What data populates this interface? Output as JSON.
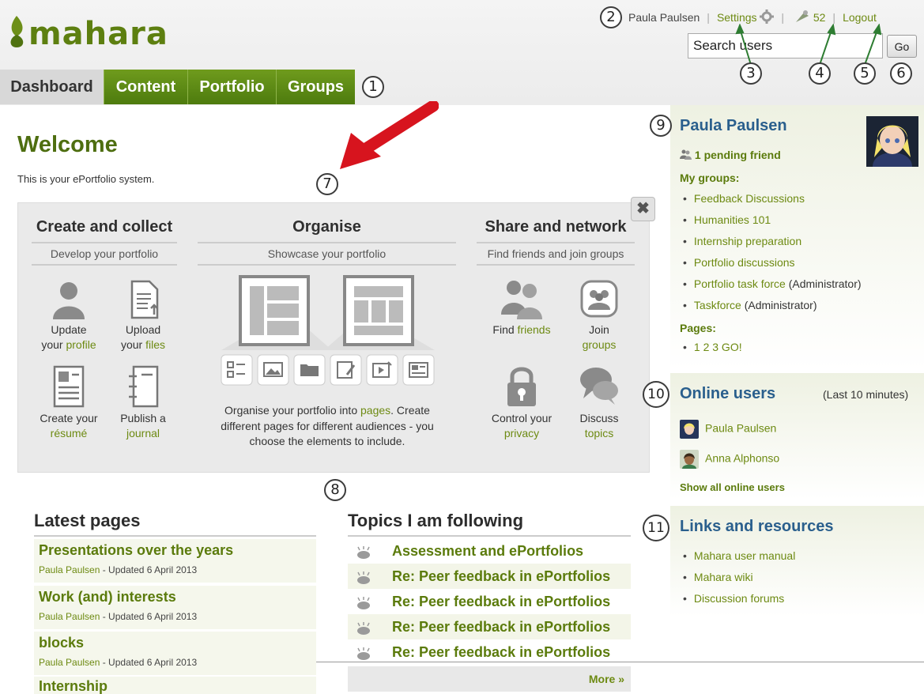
{
  "header": {
    "logo_text": "mahara",
    "user_name": "Paula Paulsen",
    "settings_label": "Settings",
    "notifications_count": "52",
    "logout_label": "Logout",
    "search_value": "Search users",
    "go_label": "Go",
    "brand_color": "#5d7f10"
  },
  "nav": {
    "tabs": [
      {
        "label": "Dashboard",
        "active": true
      },
      {
        "label": "Content",
        "active": false
      },
      {
        "label": "Portfolio",
        "active": false
      },
      {
        "label": "Groups",
        "active": false
      }
    ]
  },
  "callouts": [
    "1",
    "2",
    "3",
    "4",
    "5",
    "6",
    "7",
    "8",
    "9",
    "10",
    "11"
  ],
  "welcome": {
    "title": "Welcome",
    "subtitle": "This is your ePortfolio system."
  },
  "info": {
    "close_glyph": "✖",
    "create": {
      "title": "Create and collect",
      "subtitle": "Develop your portfolio",
      "items": [
        {
          "line1": "Update",
          "pre": "your ",
          "link": "profile",
          "icon": "person-icon"
        },
        {
          "line1": "Upload",
          "pre": "your ",
          "link": "files",
          "icon": "file-upload-icon"
        },
        {
          "line1": "Create your",
          "pre": "",
          "link": "résumé",
          "icon": "resume-icon"
        },
        {
          "line1": "Publish a",
          "pre": "",
          "link": "journal",
          "icon": "journal-icon"
        }
      ]
    },
    "organise": {
      "title": "Organise",
      "subtitle": "Showcase your portfolio",
      "text_pre": "Organise your portfolio into ",
      "text_link": "pages",
      "text_post": ". Create different pages for different audiences - you choose the elements to include."
    },
    "share": {
      "title": "Share and network",
      "subtitle": "Find friends and join groups",
      "items": [
        {
          "line1": "Find ",
          "link": "friends",
          "inline": true,
          "icon": "friends-icon"
        },
        {
          "line1": "Join",
          "link": "groups",
          "inline": false,
          "icon": "groups-icon"
        },
        {
          "line1": "Control your",
          "link": "privacy",
          "inline": false,
          "icon": "lock-icon"
        },
        {
          "line1": "Discuss",
          "link": "topics",
          "inline": false,
          "icon": "speech-bubbles-icon"
        }
      ]
    }
  },
  "latest_pages": {
    "title": "Latest pages",
    "items": [
      {
        "title": "Presentations over the years",
        "author": "Paula Paulsen",
        "meta": " - Updated 6 April 2013"
      },
      {
        "title": "Work (and) interests",
        "author": "Paula Paulsen",
        "meta": " - Updated 6 April 2013"
      },
      {
        "title": "blocks",
        "author": "Paula Paulsen",
        "meta": " - Updated 6 April 2013"
      },
      {
        "title": "Internship",
        "author": "",
        "meta": ""
      }
    ]
  },
  "topics": {
    "title": "Topics I am following",
    "items": [
      "Assessment and ePortfolios",
      "Re: Peer feedback in ePortfolios",
      "Re: Peer feedback in ePortfolios",
      "Re: Peer feedback in ePortfolios",
      "Re: Peer feedback in ePortfolios"
    ],
    "more_label": "More »"
  },
  "sidebar": {
    "profile": {
      "name": "Paula Paulsen",
      "pending": "1 pending friend",
      "groups_label": "My groups:",
      "groups": [
        {
          "name": "Feedback Discussions",
          "role": ""
        },
        {
          "name": "Humanities 101",
          "role": ""
        },
        {
          "name": "Internship preparation",
          "role": ""
        },
        {
          "name": "Portfolio discussions",
          "role": ""
        },
        {
          "name": "Portfolio task force",
          "role": " (Administrator)"
        },
        {
          "name": "Taskforce",
          "role": " (Administrator)"
        }
      ],
      "pages_label": "Pages:",
      "pages": [
        "1 2 3 GO!"
      ]
    },
    "online": {
      "title": "Online users",
      "window": "(Last 10 minutes)",
      "users": [
        "Paula Paulsen",
        "Anna Alphonso"
      ],
      "show_all": "Show all online users"
    },
    "links": {
      "title": "Links and resources",
      "items": [
        "Mahara user manual",
        "Mahara wiki",
        "Discussion forums"
      ]
    }
  }
}
